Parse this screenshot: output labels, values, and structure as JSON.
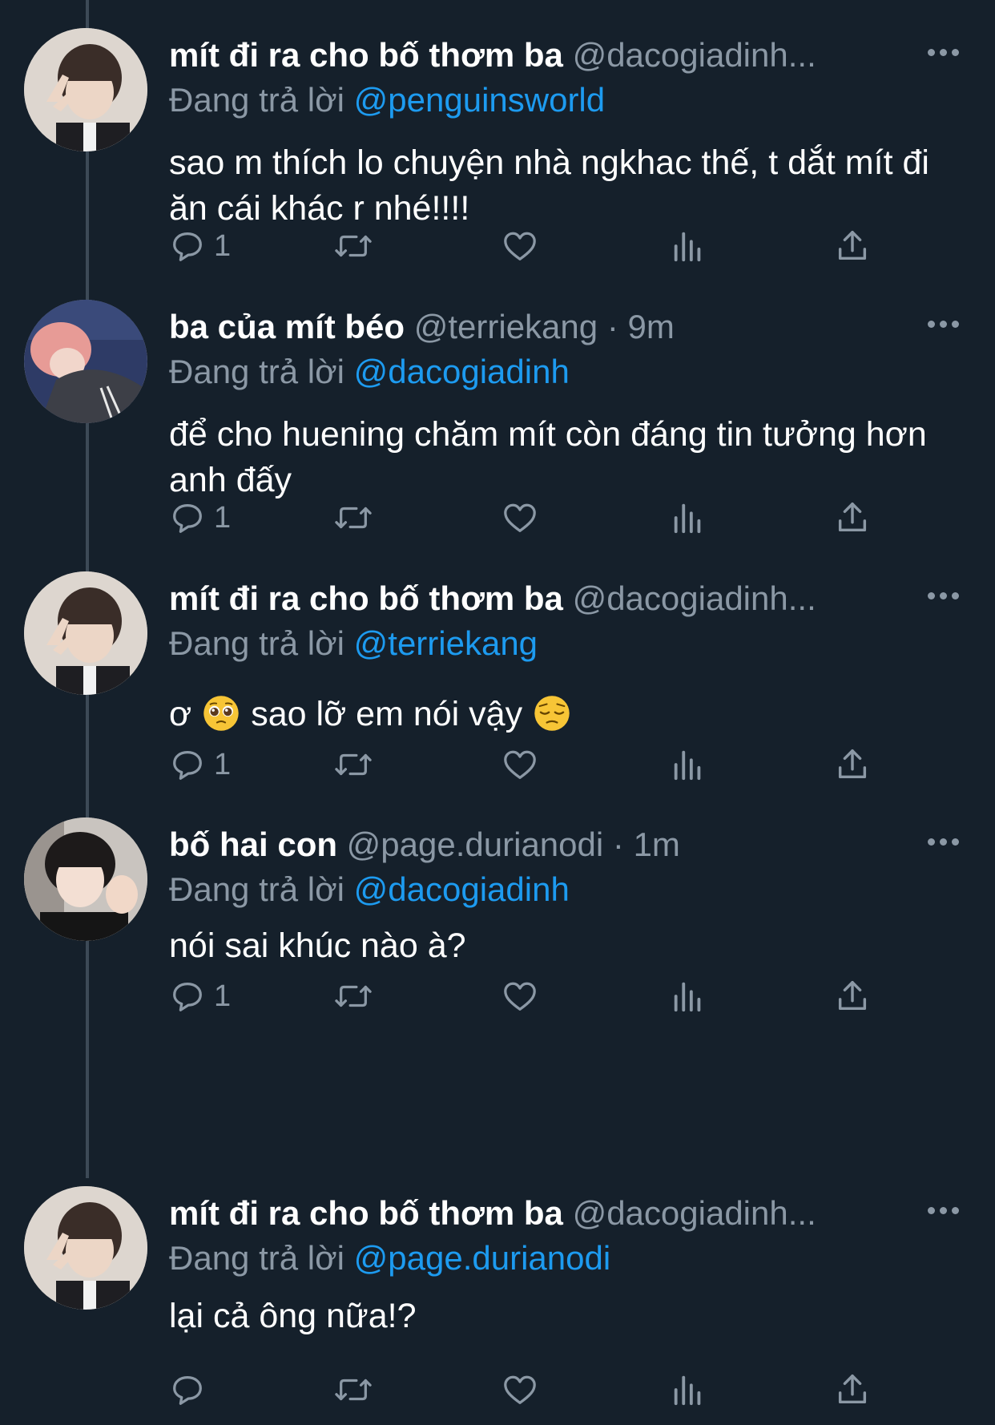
{
  "reply_prefix": "Đang trả lời",
  "tweets": [
    {
      "display_name": "mít đi ra cho bố thơm ba",
      "handle": "@dacogiadinh...",
      "time": "",
      "replying_to": "@penguinsworld",
      "text": "sao m thích lo chuyện nhà ngkhac thế, t dắt mít đi ăn cái khác r nhé!!!!",
      "reply_count": "1",
      "avatar_icon": "avatar-boy-peace-sign"
    },
    {
      "display_name": "ba của mít béo",
      "handle": "@terriekang",
      "time": "9m",
      "replying_to": "@dacogiadinh",
      "text": "để cho huening chăm mít còn đáng tin tưởng hơn anh đấy",
      "reply_count": "1",
      "avatar_icon": "avatar-pink-hair"
    },
    {
      "display_name": "mít đi ra cho bố thơm ba",
      "handle": "@dacogiadinh...",
      "time": "",
      "replying_to": "@terriekang",
      "text_part1": "ơ",
      "text_part2": "sao lỡ em nói vậy",
      "emoji_1": "pleading-face-emoji",
      "emoji_2": "pensive-face-emoji",
      "reply_count": "1",
      "avatar_icon": "avatar-boy-peace-sign"
    },
    {
      "display_name": "bố hai con",
      "handle": "@page.durianodi",
      "time": "1m",
      "replying_to": "@dacogiadinh",
      "text": "nói sai khúc nào à?",
      "reply_count": "1",
      "avatar_icon": "avatar-finger-heart"
    },
    {
      "display_name": "mít đi ra cho bố thơm ba",
      "handle": "@dacogiadinh...",
      "time": "",
      "replying_to": "@page.durianodi",
      "text": "lại cả ông nữa!?",
      "reply_count": "",
      "avatar_icon": "avatar-boy-peace-sign"
    }
  ],
  "colors": {
    "background": "#15202b",
    "text": "#ffffff",
    "secondary": "#8b98a5",
    "mention": "#1d9bf0",
    "thread_line": "#3d4a57"
  }
}
